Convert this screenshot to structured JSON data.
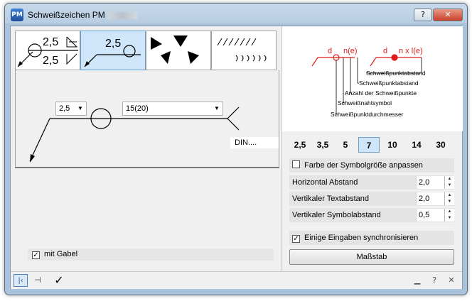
{
  "window": {
    "title": "Schweißzeichen PM"
  },
  "titlebar": {
    "help_glyph": "?",
    "close_glyph": "✕"
  },
  "tabs": [
    {
      "name": "tab-spot-weld-symbol",
      "top_value": "2,5",
      "bottom_value": "2,5"
    },
    {
      "name": "tab-spot-weld-circle",
      "value": "2,5"
    },
    {
      "name": "tab-weld-shapes"
    },
    {
      "name": "tab-weld-lines"
    }
  ],
  "symbol_editor": {
    "size_value": "2,5",
    "spacing_value": "15(20)",
    "standard_field": "DIN...."
  },
  "gabel": {
    "checked": true,
    "label": "mit Gabel",
    "check_glyph": "✓"
  },
  "preview": {
    "formula": {
      "d1": "d",
      "n1": "n(e)",
      "d2": "d",
      "formula2": "n x l(e)"
    },
    "legend": [
      "Schweißpunktabstand",
      "Schweißpunktabstand",
      "Anzahl der Schweißpunkte",
      "Schweißnahtsymbol",
      "Schweißpunktdurchmesser"
    ]
  },
  "size_buttons": [
    "2,5",
    "3,5",
    "5",
    "7",
    "10",
    "14",
    "30"
  ],
  "selected_size": "7",
  "options": {
    "symbol_size_checkbox": {
      "checked": false,
      "label": "Farbe der Symbolgröße anpassen"
    },
    "horizontal": {
      "label": "Horizontal Abstand",
      "value": "2,0"
    },
    "text_vertical": {
      "label": "Vertikaler Textabstand",
      "value": "2,0"
    },
    "symbol_vertical": {
      "label": "Vertikaler Symbolabstand",
      "value": "0,5"
    },
    "sync_checkbox": {
      "checked": true,
      "label": "Einige Eingaben synchronisieren"
    },
    "measure_button": "Maßstab"
  },
  "toolbar": {
    "collapse_glyph": "|‹",
    "pin_glyph": "⊣",
    "ok_glyph": "✓",
    "min_glyph": "▁",
    "help_glyph": "?",
    "close_glyph": "✕"
  },
  "colors": {
    "accent_red": "#e01b1b",
    "selection_blue": "#cfe6fa"
  }
}
